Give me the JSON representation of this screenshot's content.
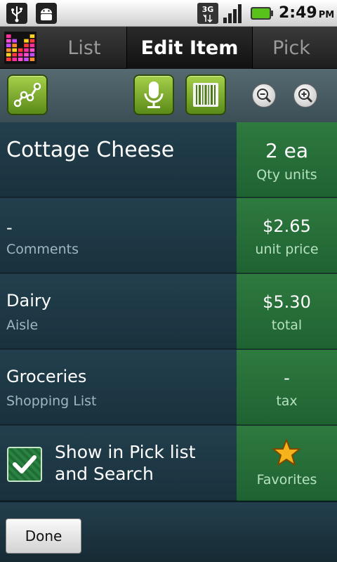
{
  "status_bar": {
    "time": "2:49",
    "ampm": "PM",
    "network": "3G",
    "icons": [
      "usb-icon",
      "android-debug-icon",
      "3g-data-icon",
      "signal-icon",
      "battery-icon"
    ]
  },
  "tabs": {
    "list": "List",
    "edit": "Edit Item",
    "pick": "Pick"
  },
  "toolbar": {
    "icons": [
      "graph-icon",
      "microphone-icon",
      "barcode-icon",
      "zoom-out-icon",
      "zoom-in-icon"
    ]
  },
  "item": {
    "name": "Cottage Cheese",
    "quantity": "2 ea",
    "quantity_label": "Qty  units",
    "comments": "-",
    "comments_label": "Comments",
    "unit_price": "$2.65",
    "unit_price_label": "unit price",
    "aisle": "Dairy",
    "aisle_label": "Aisle",
    "total": "$5.30",
    "total_label": "total",
    "shopping_list": "Groceries",
    "shopping_list_label": "Shopping List",
    "tax": "-",
    "tax_label": "tax",
    "show_in_pick_line1": "Show in Pick list",
    "show_in_pick_line2": "and Search",
    "show_in_pick_checked": true,
    "favorites_label": "Favorites"
  },
  "bottom": {
    "done_label": "Done"
  },
  "colors": {
    "row_left": "#233f4d",
    "row_right": "#2e7a3f",
    "button_green": "#8bbd36",
    "star": "#f5b21a"
  }
}
